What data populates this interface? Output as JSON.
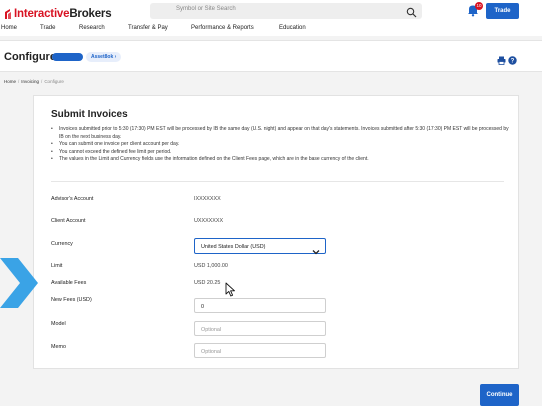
{
  "header": {
    "logo_part1": "Interactive",
    "logo_part2": "Brokers",
    "search_placeholder": "Symbol or Site Search",
    "notification_count": "10",
    "trade_label": "Trade",
    "menu": [
      "Home",
      "Trade",
      "Research",
      "Transfer & Pay",
      "Performance & Reports",
      "Education"
    ]
  },
  "subheader": {
    "title": "Configure",
    "account_pill": "Asset8ok"
  },
  "breadcrumb": [
    "Home",
    "Invoicing",
    "Configure"
  ],
  "form": {
    "title": "Submit Invoices",
    "notes": [
      "Invoices submitted prior to 5:30 (17:30) PM EST will be processed by IB the same day (U.S. night) and appear on that day's statements. Invoices submitted after 5:30 (17:30) PM EST will be processed by IB on the next business day.",
      "You can submit one invoice per client account per day.",
      "You cannot exceed the defined fee limit per period.",
      "The values in the Limit and Currency fields use the information defined on the Client Fees page, which are in the base currency of the client."
    ],
    "advisor_account_label": "Advisor's Account",
    "advisor_account_value": "IXXXXXXX",
    "client_account_label": "Client Account",
    "client_account_value": "UXXXXXXX",
    "currency_label": "Currency",
    "currency_value": "United States Dollar (USD)",
    "limit_label": "Limit",
    "limit_value": "USD 1,000.00",
    "available_fees_label": "Available Fees",
    "available_fees_value": "USD 20.25",
    "new_fees_label": "New Fees (USD)",
    "new_fees_value": "0",
    "model_label": "Model",
    "model_placeholder": "Optional",
    "memo_label": "Memo",
    "memo_placeholder": "Optional"
  },
  "continue_label": "Continue",
  "colors": {
    "brand_red": "#d81222",
    "accent_blue": "#1e64c8",
    "arrow_blue": "#3aa3e6"
  }
}
